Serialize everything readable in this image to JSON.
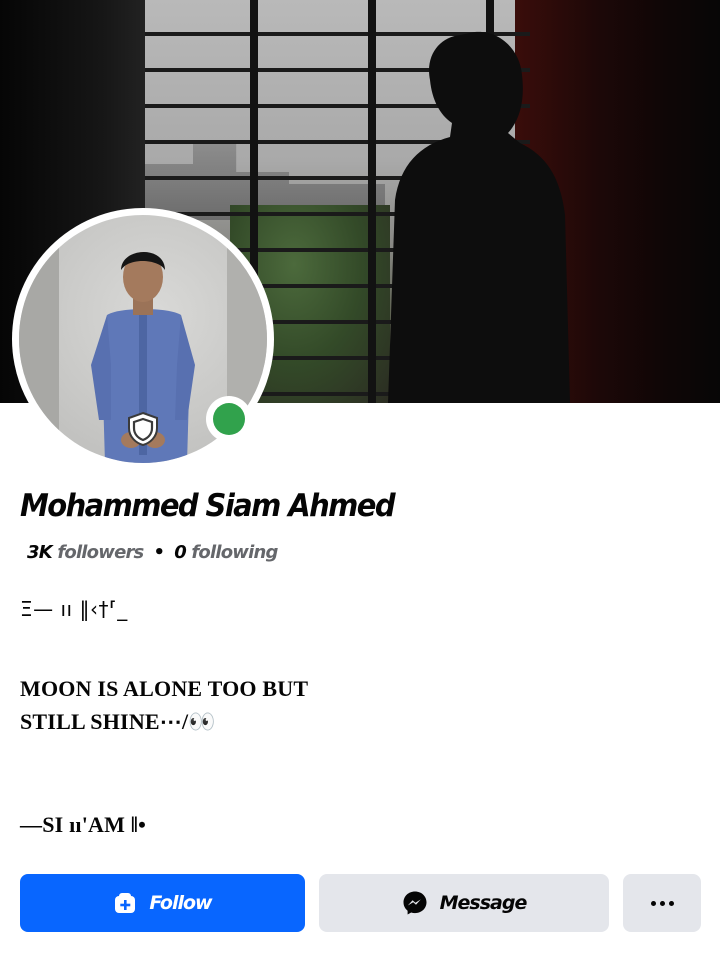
{
  "profile": {
    "name": "Mohammed Siam Ahmed",
    "followers_count": "3K",
    "followers_label": "followers",
    "separator": "•",
    "following_count": "0",
    "following_label": "following",
    "online": true
  },
  "bio": {
    "line1": "Ξ— ıı ‖‹†⸢_",
    "line2": "MOON IS ALONE TOO BUT",
    "line3": "STILL SHINE⋯/👀",
    "line4": "—SI ıı'AM ‖•"
  },
  "actions": {
    "follow_label": "Follow",
    "message_label": "Message",
    "more_icon": "more-dots-icon"
  },
  "colors": {
    "follow_bg": "#0866ff",
    "secondary_bg": "#e4e6eb",
    "online_green": "#31a24c",
    "muted_text": "#65676b"
  }
}
